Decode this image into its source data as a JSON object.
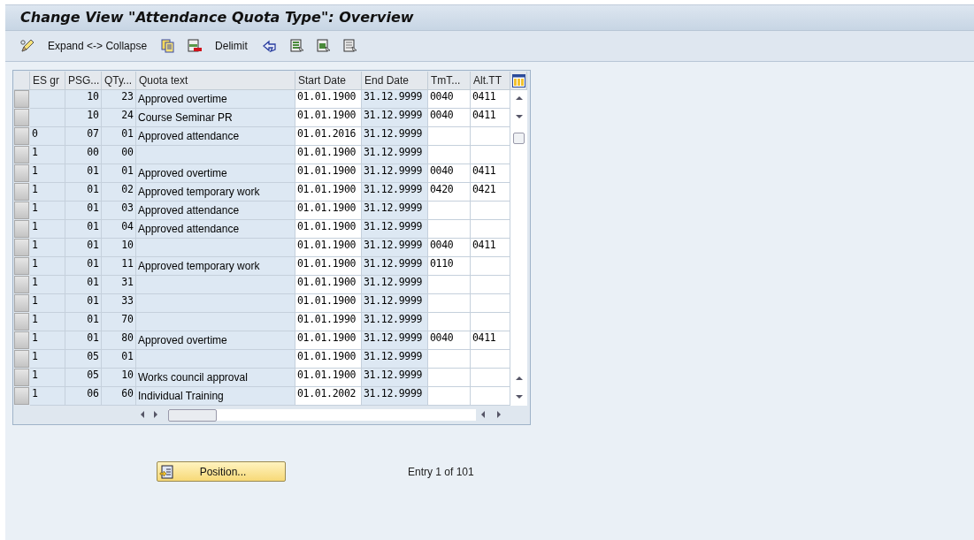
{
  "window": {
    "title": "Change View \"Attendance Quota Type\": Overview"
  },
  "toolbar": [
    {
      "kind": "icon"
    },
    {
      "kind": "text",
      "label": "Expand <-> Collapse"
    },
    {
      "kind": "icon"
    },
    {
      "kind": "icon"
    },
    {
      "kind": "text",
      "label": "Delimit"
    },
    {
      "kind": "icon"
    },
    {
      "kind": "icon"
    },
    {
      "kind": "icon"
    },
    {
      "kind": "icon"
    }
  ],
  "table": {
    "columns": [
      {
        "label": "ES gr",
        "kind": "key"
      },
      {
        "label": "PSG...",
        "kind": "key"
      },
      {
        "label": "QTy...",
        "kind": "key"
      },
      {
        "label": "Quota text",
        "kind": "key"
      },
      {
        "label": "Start Date",
        "kind": "input"
      },
      {
        "label": "End Date",
        "kind": "key"
      },
      {
        "label": "TmT...",
        "kind": "input"
      },
      {
        "label": "Alt.TT",
        "kind": "input"
      }
    ],
    "rows": [
      {
        "selected": false,
        "cells": [
          "",
          "10",
          "23",
          "Approved overtime",
          "01.01.1900",
          "31.12.9999",
          "0040",
          "0411"
        ]
      },
      {
        "selected": false,
        "cells": [
          "",
          "10",
          "24",
          "Course Seminar PR",
          "01.01.1900",
          "31.12.9999",
          "0040",
          "0411"
        ]
      },
      {
        "selected": false,
        "cells": [
          "0",
          "07",
          "01",
          "Approved attendance",
          "01.01.2016",
          "31.12.9999",
          "",
          ""
        ]
      },
      {
        "selected": false,
        "cells": [
          "1",
          "00",
          "00",
          "",
          "01.01.1900",
          "31.12.9999",
          "",
          ""
        ]
      },
      {
        "selected": false,
        "cells": [
          "1",
          "01",
          "01",
          "Approved overtime",
          "01.01.1900",
          "31.12.9999",
          "0040",
          "0411"
        ]
      },
      {
        "selected": false,
        "cells": [
          "1",
          "01",
          "02",
          "Approved temporary work",
          "01.01.1900",
          "31.12.9999",
          "0420",
          "0421"
        ]
      },
      {
        "selected": false,
        "cells": [
          "1",
          "01",
          "03",
          "Approved attendance",
          "01.01.1900",
          "31.12.9999",
          "",
          ""
        ]
      },
      {
        "selected": false,
        "cells": [
          "1",
          "01",
          "04",
          "Approved attendance",
          "01.01.1900",
          "31.12.9999",
          "",
          ""
        ]
      },
      {
        "selected": false,
        "cells": [
          "1",
          "01",
          "10",
          "",
          "01.01.1900",
          "31.12.9999",
          "0040",
          "0411"
        ]
      },
      {
        "selected": false,
        "cells": [
          "1",
          "01",
          "11",
          "Approved temporary work",
          "01.01.1900",
          "31.12.9999",
          "0110",
          ""
        ]
      },
      {
        "selected": false,
        "cells": [
          "1",
          "01",
          "31",
          "",
          "01.01.1900",
          "31.12.9999",
          "",
          ""
        ]
      },
      {
        "selected": false,
        "cells": [
          "1",
          "01",
          "33",
          "",
          "01.01.1900",
          "31.12.9999",
          "",
          ""
        ]
      },
      {
        "selected": false,
        "cells": [
          "1",
          "01",
          "70",
          "",
          "01.01.1990",
          "31.12.9999",
          "",
          ""
        ]
      },
      {
        "selected": false,
        "cells": [
          "1",
          "01",
          "80",
          "Approved overtime",
          "01.01.1900",
          "31.12.9999",
          "0040",
          "0411"
        ]
      },
      {
        "selected": false,
        "cells": [
          "1",
          "05",
          "01",
          "",
          "01.01.1900",
          "31.12.9999",
          "",
          ""
        ]
      },
      {
        "selected": false,
        "cells": [
          "1",
          "05",
          "10",
          "Works council approval",
          "01.01.1900",
          "31.12.9999",
          "",
          ""
        ]
      },
      {
        "selected": false,
        "cells": [
          "1",
          "06",
          "60",
          "Individual Training",
          "01.01.2002",
          "31.12.9999",
          "",
          ""
        ]
      }
    ]
  },
  "position_button": {
    "label": "Position..."
  },
  "entry_info": "Entry 1 of 101"
}
